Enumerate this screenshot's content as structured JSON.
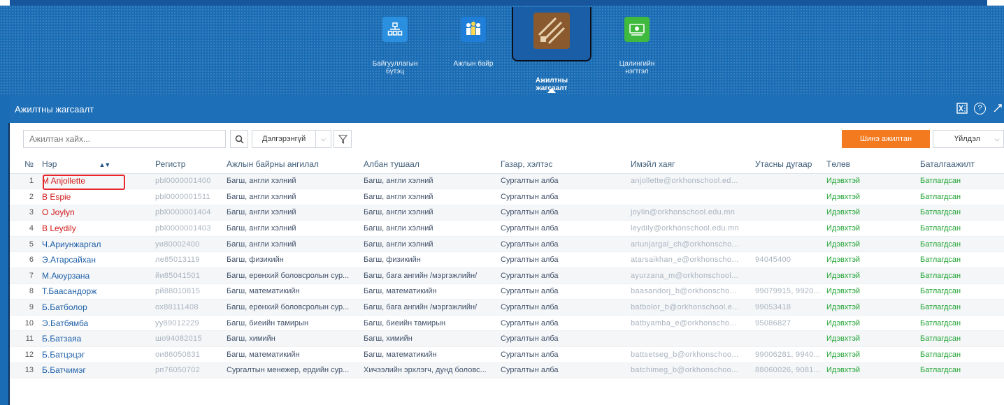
{
  "header": {
    "nav": [
      {
        "label": "Байгууллагын\nбүтэц",
        "icon": "org-structure-icon",
        "active": false
      },
      {
        "label": "Ажлын байр",
        "icon": "job-positions-icon",
        "active": false
      },
      {
        "label": "Ажилтны\nжагсаалт",
        "icon": "employee-list-icon",
        "active": true
      },
      {
        "label": "Цалингийн\nнэгтгэл",
        "icon": "payroll-icon",
        "active": false
      }
    ]
  },
  "panel": {
    "title": "Ажилтны жагсаалт",
    "search_placeholder": "Ажилтан хайх...",
    "advanced_label": "Дэлгэрэнгүй",
    "new_button_label": "Шинэ ажилтан",
    "action_label": "Үйлдэл"
  },
  "table": {
    "columns": [
      "№",
      "Нэр",
      "Регистр",
      "Ажлын байрны ангилал",
      "Албан тушаал",
      "Газар, хэлтэс",
      "Имэйл хаяг",
      "Утасны дугаар",
      "Төлөв",
      "Баталгаажилт"
    ],
    "rows": [
      {
        "no": "1",
        "name": "M Anjollette",
        "reg": "pbl0000001400",
        "category": "Багш, англи хэлний",
        "position": "Багш, англи хэлний",
        "dept": "Сургалтын алба",
        "email": "anjollette@orkhonschool.ed...",
        "phone": "",
        "status": "Идэвхтэй",
        "verify": "Батлагдсан",
        "red": true
      },
      {
        "no": "2",
        "name": "B Espie",
        "reg": "pbl0000001511",
        "category": "Багш, англи хэлний",
        "position": "Багш, англи хэлний",
        "dept": "Сургалтын алба",
        "email": "",
        "phone": "",
        "status": "Идэвхтэй",
        "verify": "Батлагдсан",
        "red": true
      },
      {
        "no": "3",
        "name": "O Joylyn",
        "reg": "pbl0000001404",
        "category": "Багш, англи хэлний",
        "position": "Багш, англи хэлний",
        "dept": "Сургалтын алба",
        "email": "joylin@orkhonschool.edu.mn",
        "phone": "",
        "status": "Идэвхтэй",
        "verify": "Батлагдсан",
        "red": true
      },
      {
        "no": "4",
        "name": "B Leydily",
        "reg": "pbl0000001403",
        "category": "Багш, англи хэлний",
        "position": "Багш, англи хэлний",
        "dept": "Сургалтын алба",
        "email": "leydily@orkhonschool.edu.mn",
        "phone": "",
        "status": "Идэвхтэй",
        "verify": "Батлагдсан",
        "red": true
      },
      {
        "no": "5",
        "name": "Ч.Ариунжаргал",
        "reg": "уи80002400",
        "category": "Багш, англи хэлний",
        "position": "Багш, англи хэлний",
        "dept": "Сургалтын алба",
        "email": "ariunjargal_ch@orkhonscho...",
        "phone": "",
        "status": "Идэвхтэй",
        "verify": "Батлагдсан",
        "red": false
      },
      {
        "no": "6",
        "name": "Э.Атарсайхан",
        "reg": "ле85013119",
        "category": "Багш, физикийн",
        "position": "Багш, физикийн",
        "dept": "Сургалтын алба",
        "email": "atarsaikhan_e@orkhonscho...",
        "phone": "94045400",
        "status": "Идэвхтэй",
        "verify": "Батлагдсан",
        "red": false
      },
      {
        "no": "7",
        "name": "М.Аюурзана",
        "reg": "йи85041501",
        "category": "Багш, ерөнхий боловсролын сур...",
        "position": "Багш, бага ангийн /мэргэжлийн/",
        "dept": "Сургалтын алба",
        "email": "ayurzana_m@orkhonschool...",
        "phone": "",
        "status": "Идэвхтэй",
        "verify": "Батлагдсан",
        "red": false
      },
      {
        "no": "8",
        "name": "Т.Баасандорж",
        "reg": "рй88010815",
        "category": "Багш, математикийн",
        "position": "Багш, математикийн",
        "dept": "Сургалтын алба",
        "email": "baasandorj_b@orkhonscho...",
        "phone": "99079915, 9920...",
        "status": "Идэвхтэй",
        "verify": "Батлагдсан",
        "red": false
      },
      {
        "no": "9",
        "name": "Б.Батболор",
        "reg": "ох88111408",
        "category": "Багш, ерөнхий боловсролын сур...",
        "position": "Багш, бага ангийн /мэргэжлийн/",
        "dept": "Сургалтын алба",
        "email": "batbolor_b@orkhonschool.e...",
        "phone": "99053418",
        "status": "Идэвхтэй",
        "verify": "Батлагдсан",
        "red": false
      },
      {
        "no": "10",
        "name": "Э.Батбямба",
        "reg": "уу89012229",
        "category": "Багш, биеийн тамирын",
        "position": "Багш, биеийн тамирын",
        "dept": "Сургалтын алба",
        "email": "batbyamba_e@orkhonscho...",
        "phone": "95086827",
        "status": "Идэвхтэй",
        "verify": "Батлагдсан",
        "red": false
      },
      {
        "no": "11",
        "name": "Б.Батзаяа",
        "reg": "шо94082015",
        "category": "Багш, химийн",
        "position": "Багш, химийн",
        "dept": "Сургалтын алба",
        "email": "",
        "phone": "",
        "status": "Идэвхтэй",
        "verify": "Батлагдсан",
        "red": false
      },
      {
        "no": "12",
        "name": "Б.Батцэцэг",
        "reg": "ои86050831",
        "category": "Багш, математикийн",
        "position": "Багш, математикийн",
        "dept": "Сургалтын алба",
        "email": "battsetseg_b@orkhonschoo...",
        "phone": "99006281, 9940...",
        "status": "Идэвхтэй",
        "verify": "Батлагдсан",
        "red": false
      },
      {
        "no": "13",
        "name": "Б.Батчимэг",
        "reg": "рп76050702",
        "category": "Сургалтын менежер, ердийн сур...",
        "position": "Хичээлийн эрхлэгч, дунд боловс...",
        "dept": "Сургалтын алба",
        "email": "batchimeg_b@orkhonschoo...",
        "phone": "88060026, 9081...",
        "status": "Идэвхтэй",
        "verify": "Батлагдсан",
        "red": false
      }
    ]
  }
}
